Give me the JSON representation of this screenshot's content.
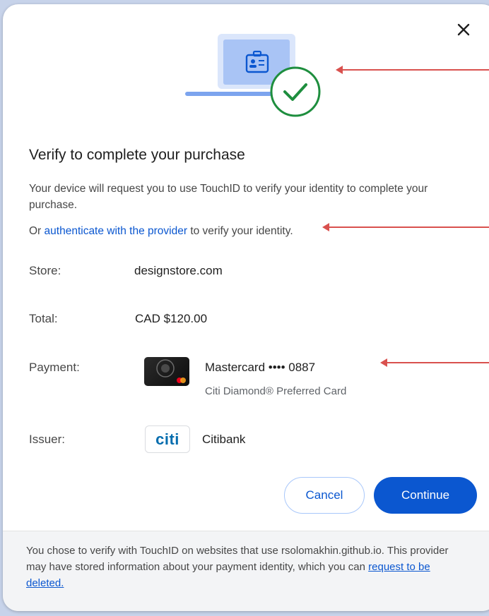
{
  "dialog": {
    "title": "Verify to complete your purchase",
    "description": "Your device will request you to use TouchID to verify your identity to complete your purchase.",
    "alt_prefix": "Or ",
    "alt_link": "authenticate with the provider",
    "alt_suffix": " to verify your identity.",
    "close_icon": "close-icon",
    "hero_icon": "laptop-id-check-icon"
  },
  "details": {
    "store_label": "Store:",
    "store_value": "designstore.com",
    "total_label": "Total:",
    "total_value": "CAD $120.00",
    "payment_label": "Payment:",
    "payment_card": "Mastercard •••• 0887",
    "payment_card_sub": "Citi Diamond® Preferred Card",
    "issuer_label": "Issuer:",
    "issuer_value": "Citibank",
    "issuer_logo_text": "citi"
  },
  "buttons": {
    "cancel": "Cancel",
    "continue": "Continue"
  },
  "footer": {
    "text": "You chose to verify with TouchID on websites that use rsolomakhin.github.io. This provider may have stored information about your payment identity, which you can ",
    "link": "request to be deleted."
  },
  "colors": {
    "accent": "#0b57d0",
    "success": "#1e8e3e",
    "annotation": "#d9514e"
  }
}
